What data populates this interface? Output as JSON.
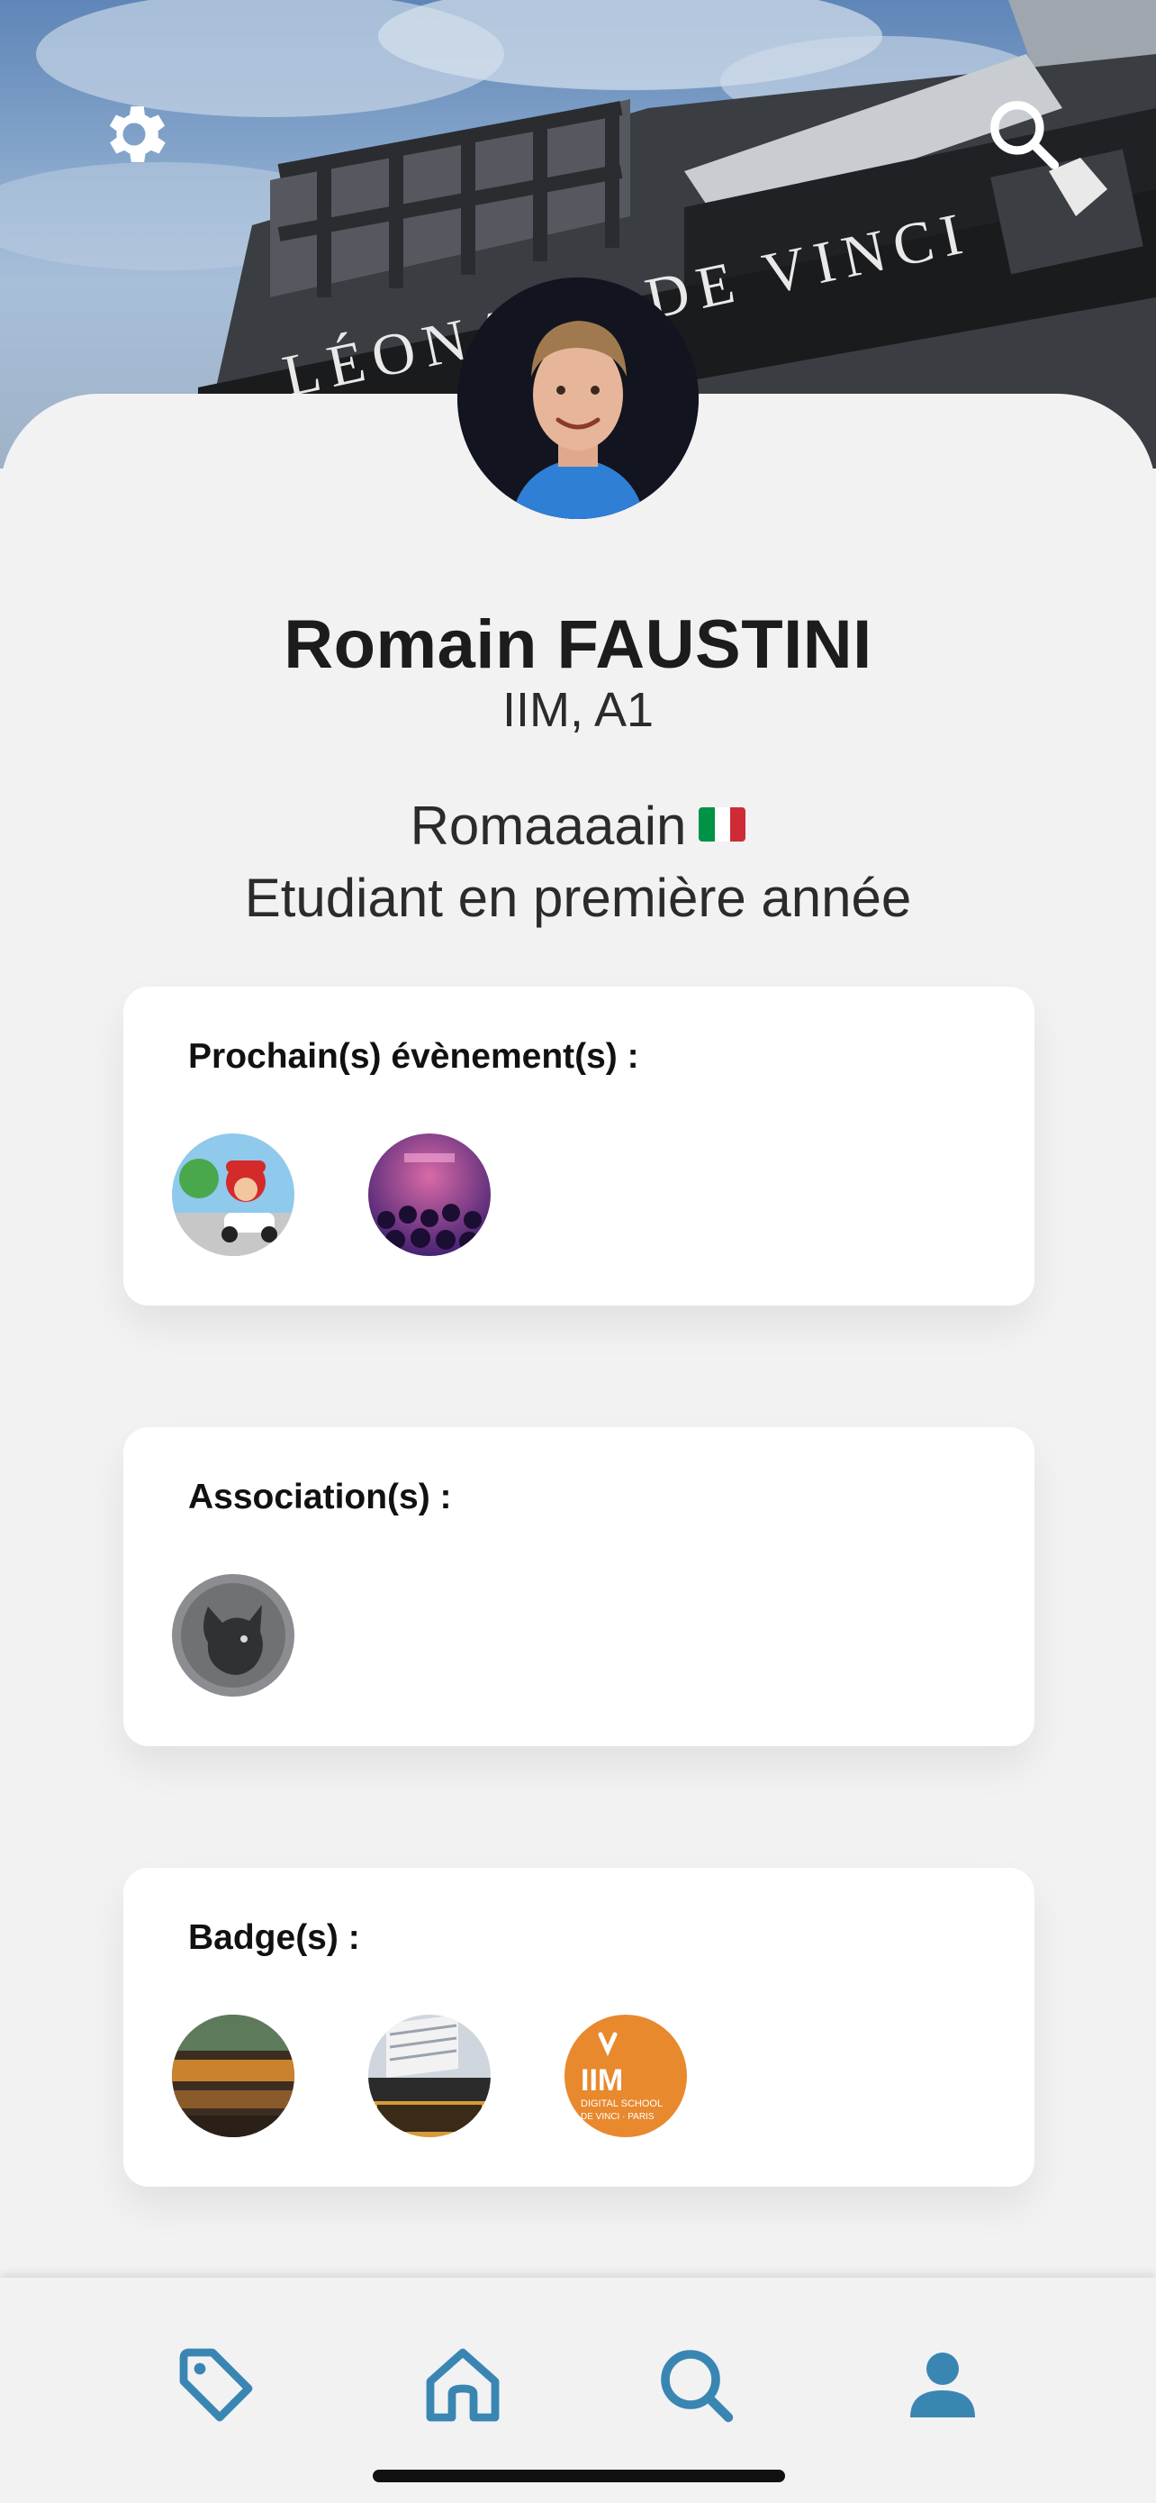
{
  "header": {
    "settings_icon": "gear-icon",
    "search_icon": "search-icon"
  },
  "profile": {
    "name": "Romain FAUSTINI",
    "school": "IIM, A1",
    "nickname": "Romaaaain",
    "nickname_flag": "italy-flag",
    "bio": "Etudiant en première année"
  },
  "cards": {
    "events": {
      "title": "Prochain(s) évènement(s) :",
      "items": [
        "event-mario-kart",
        "event-party"
      ]
    },
    "associations": {
      "title": "Association(s) :",
      "items": [
        "association-wolf"
      ]
    },
    "badges": {
      "title": "Badge(s) :",
      "items": [
        "badge-night",
        "badge-building",
        "badge-iim"
      ]
    }
  },
  "badge_iim_text": {
    "logo": "IIM",
    "line1": "DIGITAL SCHOOL",
    "line2": "DE VINCI · PARIS"
  },
  "nav": {
    "items": [
      "tag-icon",
      "home-icon",
      "search-icon",
      "user-icon"
    ],
    "active": "user-icon"
  },
  "colors": {
    "accent": "#3a86b3",
    "background": "#f2f2f3",
    "card": "#ffffff",
    "iim_orange": "#e8892e",
    "flag": [
      "#009246",
      "#ffffff",
      "#ce2b37"
    ]
  }
}
